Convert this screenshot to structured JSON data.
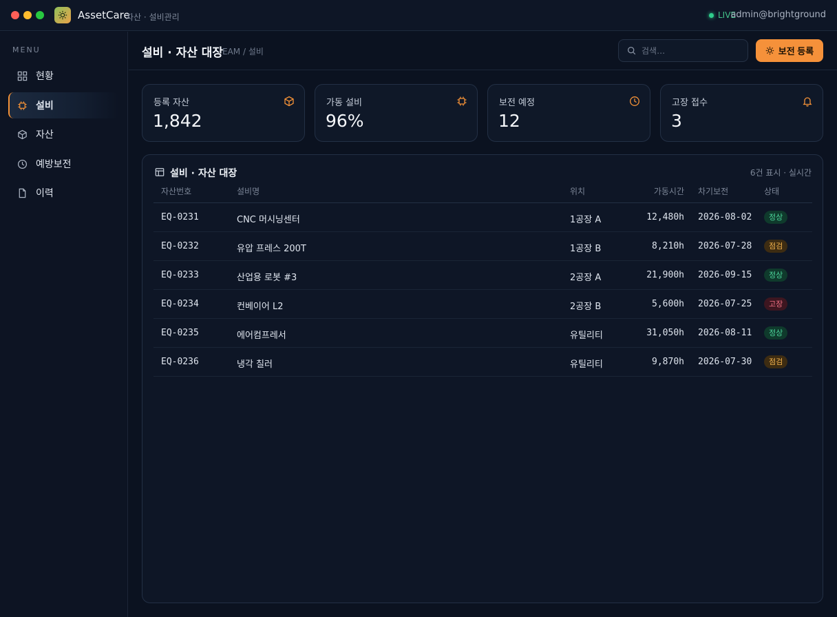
{
  "app": {
    "name": "AssetCare",
    "subtitle": "자산 · 설비관리",
    "live_label": "LIVE",
    "user": "admin@brightground"
  },
  "sidebar": {
    "menu_label": "MENU",
    "items": [
      {
        "label": "현황",
        "icon": "grid-icon",
        "active": false
      },
      {
        "label": "설비",
        "icon": "chip-icon",
        "active": true
      },
      {
        "label": "자산",
        "icon": "cube-icon",
        "active": false
      },
      {
        "label": "예방보전",
        "icon": "clock-icon",
        "active": false
      },
      {
        "label": "이력",
        "icon": "document-icon",
        "active": false
      }
    ]
  },
  "header": {
    "title": "설비 · 자산 대장",
    "breadcrumb": "EAM / 설비",
    "search_placeholder": "검색…",
    "primary_button": "보전 등록"
  },
  "kpis": [
    {
      "label": "등록 자산",
      "value": "1,842",
      "icon": "cube-icon"
    },
    {
      "label": "가동 설비",
      "value": "96%",
      "icon": "chip-icon"
    },
    {
      "label": "보전 예정",
      "value": "12",
      "icon": "clock-icon"
    },
    {
      "label": "고장 접수",
      "value": "3",
      "icon": "bell-icon"
    }
  ],
  "table": {
    "title": "설비 · 자산 대장",
    "meta": "6건 표시 · 실시간",
    "columns": [
      "자산번호",
      "설비명",
      "위치",
      "가동시간",
      "차기보전",
      "상태"
    ],
    "rows": [
      {
        "id": "EQ-0231",
        "name": "CNC 머시닝센터",
        "location": "1공장 A",
        "hours": "12,480h",
        "next": "2026-08-02",
        "status": "정상",
        "status_type": "ok"
      },
      {
        "id": "EQ-0232",
        "name": "유압 프레스 200T",
        "location": "1공장 B",
        "hours": "8,210h",
        "next": "2026-07-28",
        "status": "점검",
        "status_type": "warn"
      },
      {
        "id": "EQ-0233",
        "name": "산업용 로봇 #3",
        "location": "2공장 A",
        "hours": "21,900h",
        "next": "2026-09-15",
        "status": "정상",
        "status_type": "ok"
      },
      {
        "id": "EQ-0234",
        "name": "컨베이어 L2",
        "location": "2공장 B",
        "hours": "5,600h",
        "next": "2026-07-25",
        "status": "고장",
        "status_type": "err"
      },
      {
        "id": "EQ-0235",
        "name": "에어컴프레서",
        "location": "유틸리티",
        "hours": "31,050h",
        "next": "2026-08-11",
        "status": "정상",
        "status_type": "ok"
      },
      {
        "id": "EQ-0236",
        "name": "냉각 칠러",
        "location": "유틸리티",
        "hours": "9,870h",
        "next": "2026-07-30",
        "status": "점검",
        "status_type": "warn"
      }
    ]
  },
  "colors": {
    "accent": "#f5913a",
    "ok": "#4bd49a",
    "warn": "#f2b24c",
    "err": "#f07083"
  }
}
